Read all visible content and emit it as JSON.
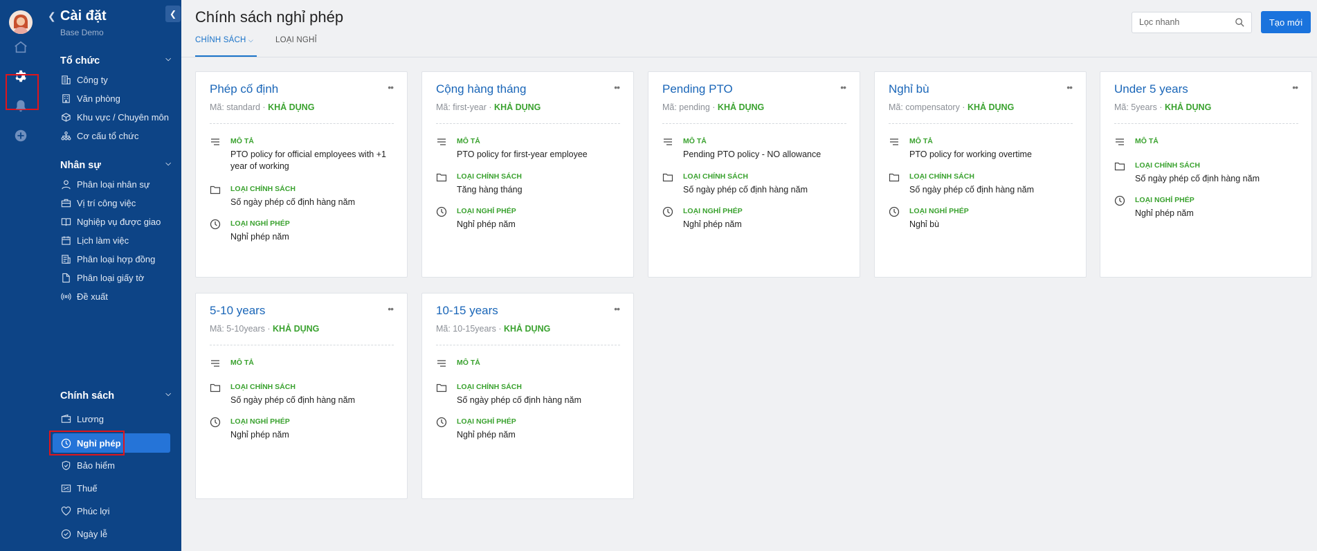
{
  "sidebar": {
    "title": "Cài đặt",
    "subtitle": "Base Demo",
    "sections": [
      {
        "title": "Tổ chức",
        "items": [
          {
            "label": "Công ty",
            "icon": "building-icon"
          },
          {
            "label": "Văn phòng",
            "icon": "office-icon"
          },
          {
            "label": "Khu vực / Chuyên môn",
            "icon": "cube-icon"
          },
          {
            "label": "Cơ cấu tổ chức",
            "icon": "org-chart-icon"
          }
        ]
      },
      {
        "title": "Nhân sự",
        "items": [
          {
            "label": "Phân loại nhân sự",
            "icon": "user-icon"
          },
          {
            "label": "Vị trí công việc",
            "icon": "briefcase-icon"
          },
          {
            "label": "Nghiệp vụ được giao",
            "icon": "book-icon"
          },
          {
            "label": "Lịch làm việc",
            "icon": "calendar-icon"
          },
          {
            "label": "Phân loại hợp đồng",
            "icon": "contract-icon"
          },
          {
            "label": "Phân loại giấy tờ",
            "icon": "document-icon"
          },
          {
            "label": "Đề xuất",
            "icon": "broadcast-icon"
          }
        ]
      },
      {
        "title": "Chính sách",
        "items": [
          {
            "label": "Lương",
            "icon": "wallet-icon"
          },
          {
            "label": "Nghỉ phép",
            "icon": "clock-icon",
            "active": true
          },
          {
            "label": "Bảo hiểm",
            "icon": "shield-icon"
          },
          {
            "label": "Thuế",
            "icon": "tax-icon"
          },
          {
            "label": "Phúc lợi",
            "icon": "heart-icon"
          },
          {
            "label": "Ngày lễ",
            "icon": "check-circle-icon"
          }
        ]
      }
    ]
  },
  "header": {
    "title": "Chính sách nghỉ phép",
    "tabs": [
      {
        "label": "CHÍNH SÁCH",
        "active": true
      },
      {
        "label": "LOẠI NGHỈ",
        "active": false
      }
    ],
    "search_placeholder": "Lọc nhanh",
    "new_button": "Tạo mới"
  },
  "field_labels": {
    "description": "MÔ TẢ",
    "policy_type": "LOẠI CHÍNH SÁCH",
    "leave_type": "LOẠI NGHỈ PHÉP"
  },
  "cards": [
    {
      "title": "Phép cố định",
      "code": "Mã: standard ·",
      "status": "KHẢ DỤNG",
      "description": "PTO policy for official employees with +1 year of working",
      "policy_type": "Số ngày phép cố định hàng năm",
      "leave_type": "Nghỉ phép năm"
    },
    {
      "title": "Cộng hàng tháng",
      "code": "Mã: first-year ·",
      "status": "KHẢ DỤNG",
      "description": "PTO policy for first-year employee",
      "policy_type": "Tăng hàng tháng",
      "leave_type": "Nghỉ phép năm"
    },
    {
      "title": "Pending PTO",
      "code": "Mã: pending ·",
      "status": "KHẢ DỤNG",
      "description": "Pending PTO policy - NO allowance",
      "policy_type": "Số ngày phép cố định hàng năm",
      "leave_type": "Nghỉ phép năm"
    },
    {
      "title": "Nghỉ bù",
      "code": "Mã: compensatory ·",
      "status": "KHẢ DỤNG",
      "description": "PTO policy for working overtime",
      "policy_type": "Số ngày phép cố định hàng năm",
      "leave_type": "Nghỉ bù"
    },
    {
      "title": "Under 5 years",
      "code": "Mã: 5years ·",
      "status": "KHẢ DỤNG",
      "description": "",
      "policy_type": "Số ngày phép cố định hàng năm",
      "leave_type": "Nghỉ phép năm"
    },
    {
      "title": "5-10 years",
      "code": "Mã: 5-10years ·",
      "status": "KHẢ DỤNG",
      "description": "",
      "policy_type": "Số ngày phép cố định hàng năm",
      "leave_type": "Nghỉ phép năm"
    },
    {
      "title": "10-15 years",
      "code": "Mã: 10-15years ·",
      "status": "KHẢ DỤNG",
      "description": "",
      "policy_type": "Số ngày phép cố định hàng năm",
      "leave_type": "Nghỉ phép năm"
    }
  ],
  "colors": {
    "sidebar_bg": "#0d4486",
    "accent": "#1a73dd",
    "status_green": "#3aa22f",
    "highlight_red": "#e0151b"
  }
}
